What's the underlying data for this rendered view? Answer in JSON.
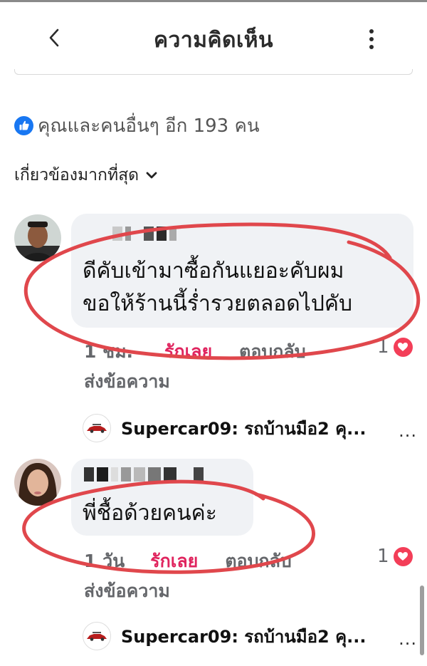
{
  "header": {
    "title": "ความคิดเห็น",
    "back_icon": "chevron-left-icon",
    "more_icon": "vertical-dots-icon"
  },
  "reactions": {
    "icon": "like-icon",
    "text": "คุณและคนอื่นๆ อีก 193 คน"
  },
  "sort": {
    "label": "เกี่ยวข้องมากที่สุด",
    "icon": "chevron-down-icon"
  },
  "comments": [
    {
      "text_line1": "ดีคับเข้ามาซื้อกันแยอะคับผม",
      "text_line2": "ขอให้ร้านนี้ร่ำรวยตลอดไปคับ",
      "time": "1 ชม.",
      "love_label": "รักเลย",
      "reply_label": "ตอบกลับ",
      "send_label": "ส่งข้อความ",
      "reaction_count": "1",
      "reply_preview": "Supercar09: รถบ้านมือ2 คุ...",
      "reply_more": "..."
    },
    {
      "text_line1": "พี่ชื้อด้วยคนค่ะ",
      "time": "1 วัน",
      "love_label": "รักเลย",
      "reply_label": "ตอบกลับ",
      "send_label": "ส่งข้อความ",
      "reaction_count": "1",
      "reply_preview": "Supercar09: รถบ้านมือ2 คุ...",
      "reply_more": "..."
    }
  ],
  "colors": {
    "like_blue": "#1877f2",
    "heart_red": "#f33e58",
    "annotation_red": "#e0474c",
    "bubble_bg": "#f0f2f5"
  }
}
